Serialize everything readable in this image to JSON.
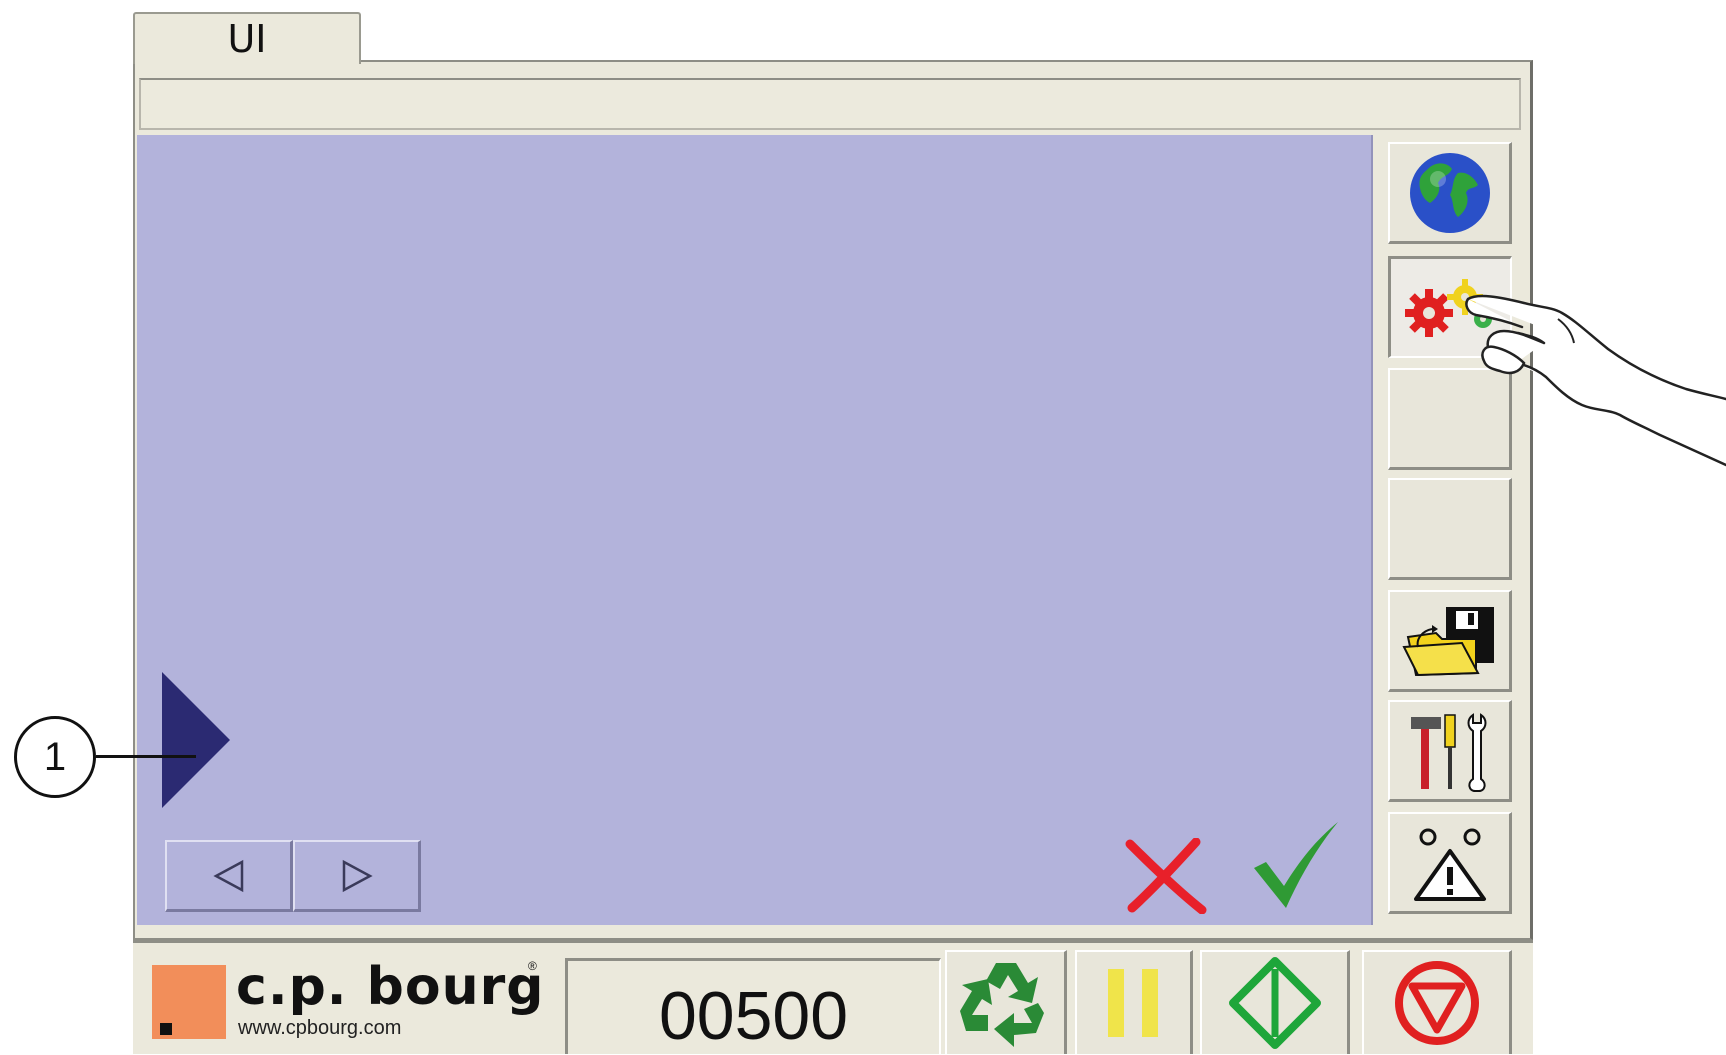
{
  "tab": {
    "label": "UI"
  },
  "titlebar": {
    "text": ""
  },
  "callout": {
    "number": "1"
  },
  "sidebar": {
    "buttons": [
      {
        "icon": "globe-icon"
      },
      {
        "icon": "gears-icon",
        "state": "pressed"
      },
      {
        "icon": ""
      },
      {
        "icon": ""
      },
      {
        "icon": "folder-disk-icon"
      },
      {
        "icon": "tools-icon"
      },
      {
        "icon": "warning-icon"
      }
    ]
  },
  "nav": {
    "prev_icon": "triangle-left-icon",
    "next_icon": "triangle-right-icon"
  },
  "actions": {
    "cancel_icon": "red-x-icon",
    "confirm_icon": "green-check-icon"
  },
  "bottom": {
    "logo_text": "c.p. bourg",
    "logo_url": "www.cpbourg.com",
    "logo_reg": "®",
    "counter": "00500",
    "recycle_icon": "recycle-icon",
    "pause_icon": "pause-icon",
    "start_icon": "start-icon",
    "stop_icon": "stop-icon"
  },
  "colors": {
    "panel": "#ebe9dc",
    "work_area": "#b3b3db",
    "indicator": "#2b2a72",
    "logo_square": "#f28e5a",
    "cancel": "#e8202a",
    "confirm": "#2f9a34",
    "pause": "#f0e44a",
    "start": "#1ea63a",
    "stop": "#e02020"
  }
}
